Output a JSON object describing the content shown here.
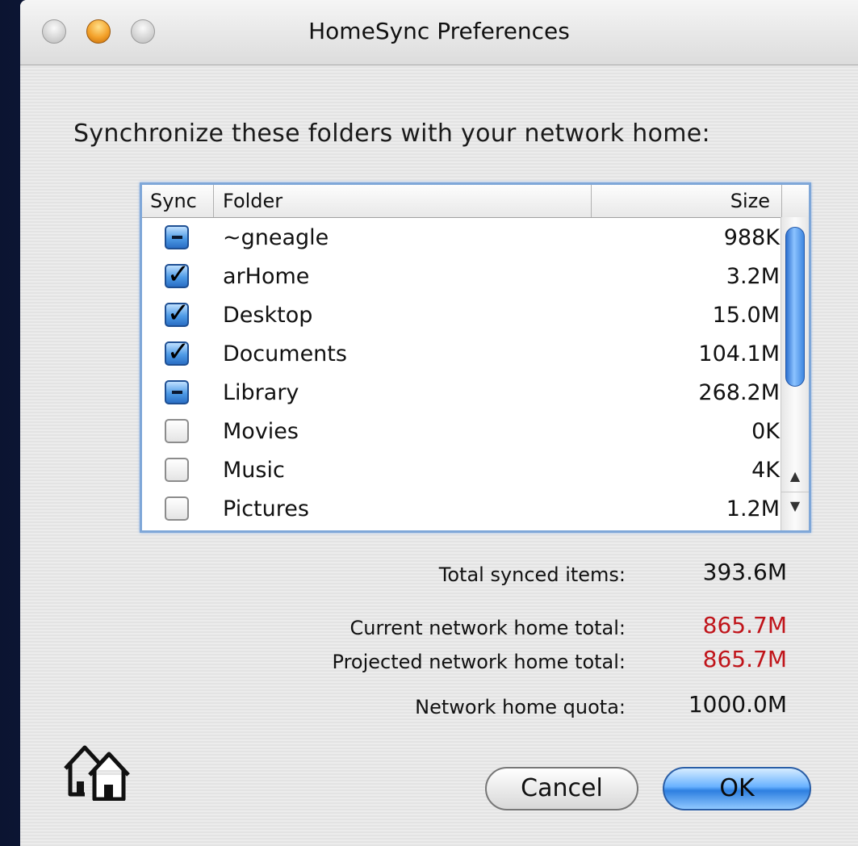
{
  "window": {
    "title": "HomeSync Preferences"
  },
  "heading": "Synchronize these folders with your network home:",
  "table": {
    "columns": {
      "sync": "Sync",
      "folder": "Folder",
      "size": "Size"
    },
    "rows": [
      {
        "state": "mixed",
        "folder": "~gneagle",
        "size": "988K"
      },
      {
        "state": "checked",
        "folder": "arHome",
        "size": "3.2M"
      },
      {
        "state": "checked",
        "folder": "Desktop",
        "size": "15.0M"
      },
      {
        "state": "checked",
        "folder": "Documents",
        "size": "104.1M"
      },
      {
        "state": "mixed",
        "folder": "Library",
        "size": "268.2M"
      },
      {
        "state": "unchecked",
        "folder": "Movies",
        "size": "0K"
      },
      {
        "state": "unchecked",
        "folder": "Music",
        "size": "4K"
      },
      {
        "state": "unchecked",
        "folder": "Pictures",
        "size": "1.2M"
      }
    ]
  },
  "summary": {
    "total_synced_label": "Total synced items:",
    "total_synced_value": "393.6M",
    "current_label": "Current network home total:",
    "current_value": "865.7M",
    "projected_label": "Projected network home total:",
    "projected_value": "865.7M",
    "quota_label": "Network home quota:",
    "quota_value": "1000.0M"
  },
  "buttons": {
    "cancel": "Cancel",
    "ok": "OK"
  },
  "colors": {
    "warning_value": "#c0141a",
    "normal_value": "#111111",
    "accent": "#2d7fe0"
  }
}
